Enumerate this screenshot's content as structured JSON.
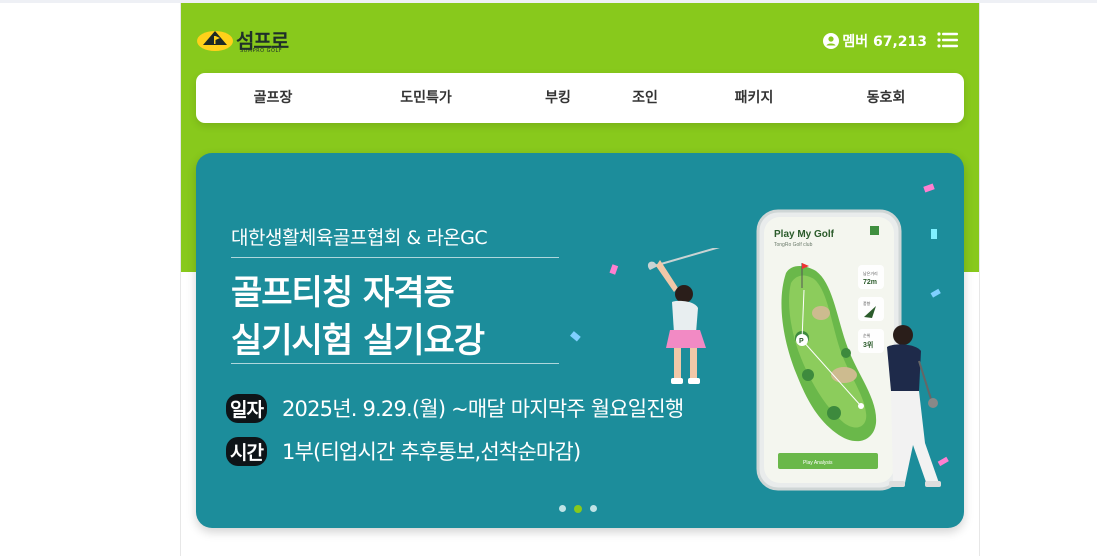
{
  "header": {
    "logo_text": "섬프로",
    "logo_sub": "SUMPRO GOLF",
    "member_label": "멤버 67,213",
    "icons": {
      "member": "user-circle-icon",
      "menu": "hamburger-menu-icon"
    }
  },
  "nav": {
    "items": [
      {
        "label": "골프장"
      },
      {
        "label": "도민특가"
      },
      {
        "label": "부킹"
      },
      {
        "label": "조인"
      },
      {
        "label": "패키지"
      },
      {
        "label": "동호회"
      }
    ]
  },
  "banner": {
    "subtitle": "대한생활체육골프협회  & 라온GC",
    "title_line1": "골프티칭 자격증",
    "title_line2": "실기시험 실기요강",
    "date_tag": "일자",
    "date_text": "2025년. 9.29.(월) ~매달 마지막주 월요일진행",
    "time_tag": "시간",
    "time_text": "1부(티업시간 추후통보,선착순마감)",
    "phone": {
      "app_title": "Play My Golf",
      "app_sub": "TongRo Golf club",
      "distance_label": "남은거리",
      "distance_value": "72m",
      "wind_label": "풍향",
      "rank_label": "순위",
      "rank_value": "3위",
      "button_label": "Play Analysis"
    },
    "slide_count": 3,
    "active_slide": 2
  },
  "colors": {
    "brand_green": "#88c91c",
    "banner_teal": "#1c8d9b",
    "nav_text": "#333333"
  }
}
